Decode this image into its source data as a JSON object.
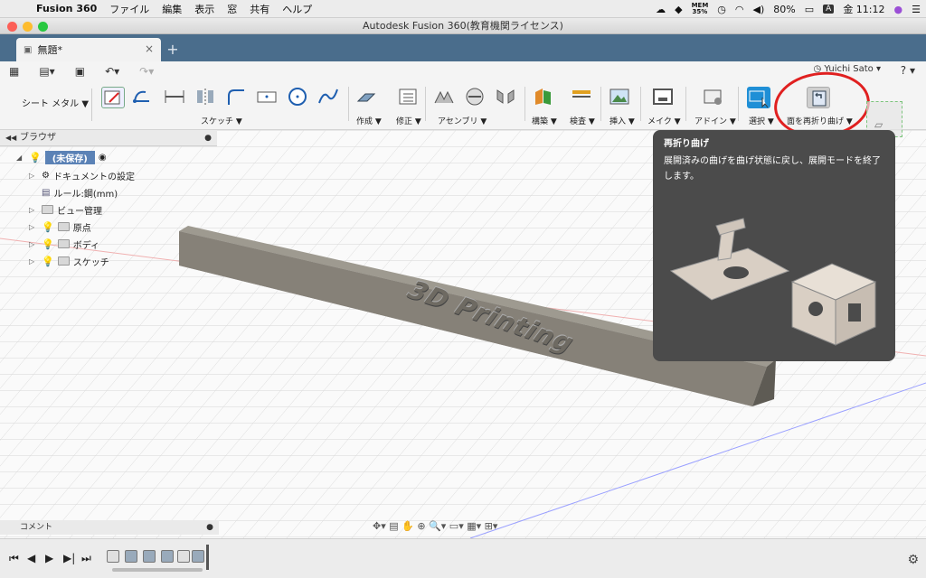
{
  "menubar": {
    "app_name": "Fusion 360",
    "items": [
      "ファイル",
      "編集",
      "表示",
      "窓",
      "共有",
      "ヘルプ"
    ],
    "mem_label": "MEM",
    "mem_value": "35%",
    "battery": "80%",
    "input_mode": "A",
    "clock": "金 11:12"
  },
  "window": {
    "title": "Autodesk Fusion 360(教育機関ライセンス)"
  },
  "tab": {
    "label": "無題*",
    "close": "×",
    "new": "+"
  },
  "user": {
    "name": "Yuichi Sato",
    "help": "?"
  },
  "toolbar": {
    "workspace": "シート メタル ▼",
    "groups": {
      "sketch": "スケッチ ▼",
      "create": "作成 ▼",
      "modify": "修正 ▼",
      "assemble": "アセンブリ ▼",
      "construct": "構築 ▼",
      "inspect": "検査 ▼",
      "insert": "挿入 ▼",
      "make": "メイク ▼",
      "addins": "アドイン ▼",
      "select": "選択 ▼",
      "refold": "面を再折り曲げ ▼"
    }
  },
  "browser": {
    "title": "ブラウザ",
    "root": "(未保存)",
    "items": [
      "ドキュメントの設定",
      "ルール:鋼(mm)",
      "ビュー管理",
      "原点",
      "ボディ",
      "スケッチ"
    ]
  },
  "model": {
    "text": "3D Printing"
  },
  "tooltip": {
    "title": "再折り曲げ",
    "description": "展開済みの曲げを曲げ状態に戻し、展開モードを終了します。"
  },
  "comment": {
    "label": "コメント"
  },
  "colors": {
    "tab_bg": "#4a6d8c",
    "select_blue": "#1f8fd6",
    "highlight_red": "#e02020"
  }
}
